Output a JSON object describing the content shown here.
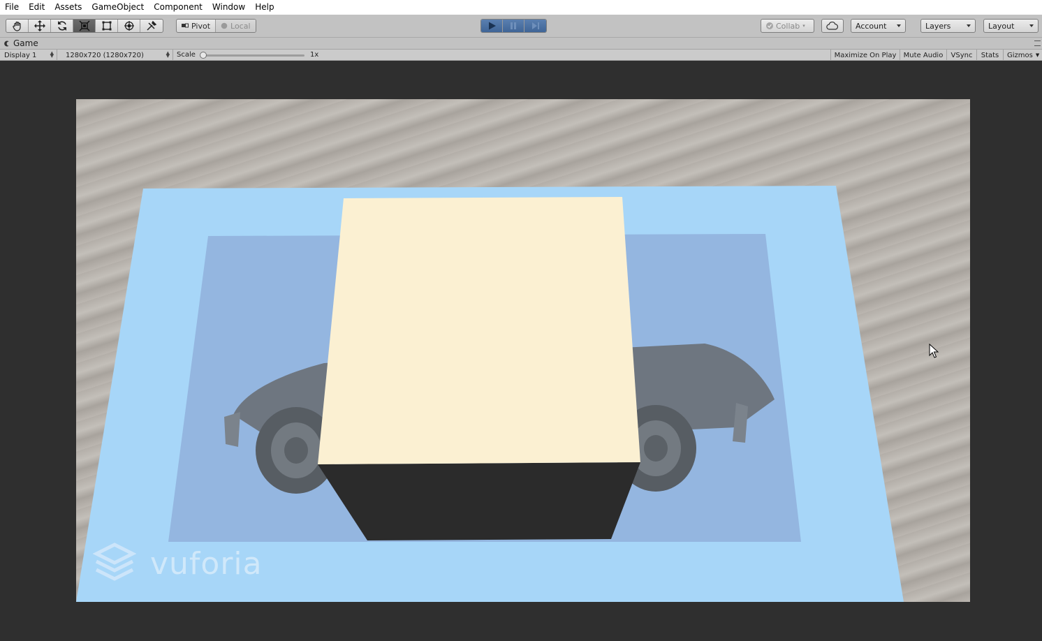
{
  "menubar": {
    "items": [
      "File",
      "Edit",
      "Assets",
      "GameObject",
      "Component",
      "Window",
      "Help"
    ]
  },
  "toolbar": {
    "tools": [
      {
        "icon": "hand-icon",
        "active": false
      },
      {
        "icon": "move-icon",
        "active": false
      },
      {
        "icon": "rotate-icon",
        "active": false
      },
      {
        "icon": "scale-icon",
        "active": true
      },
      {
        "icon": "rect-tool-icon",
        "active": false
      },
      {
        "icon": "transform-icon",
        "active": false
      },
      {
        "icon": "custom-tool-icon",
        "active": false
      }
    ],
    "pivot_label": "Pivot",
    "local_label": "Local",
    "play_controls": [
      "play-icon",
      "pause-icon",
      "step-icon"
    ],
    "collab_label": "Collab",
    "account_label": "Account",
    "layers_label": "Layers",
    "layout_label": "Layout"
  },
  "game_tab": {
    "title": "Game"
  },
  "game_bar": {
    "display": "Display 1",
    "resolution": "1280x720 (1280x720)",
    "scale_label": "Scale",
    "scale_value": "1x",
    "maximize_on_play": "Maximize On Play",
    "mute_audio": "Mute Audio",
    "vsync": "VSync",
    "stats": "Stats",
    "gizmos": "Gizmos"
  },
  "viewport": {
    "watermark": "vuforia",
    "colors": {
      "image_target": "#a7d6f8",
      "cube_top": "#fbf0d2",
      "cube_front": "#2b2b2b"
    }
  }
}
